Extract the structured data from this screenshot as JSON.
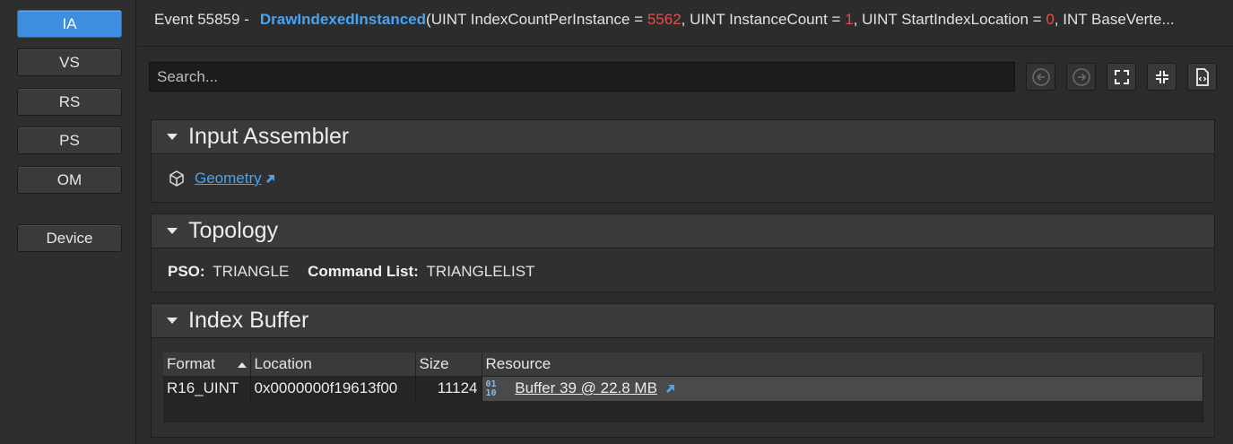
{
  "stages": [
    {
      "label": "IA",
      "active": true
    },
    {
      "label": "VS"
    },
    {
      "label": "RS"
    },
    {
      "label": "PS"
    },
    {
      "label": "OM"
    },
    {
      "label": "Device"
    }
  ],
  "event": {
    "prefix": "Event 55859 -",
    "function": "DrawIndexedInstanced",
    "params_text_1": "(UINT IndexCountPerInstance = ",
    "value_1": "5562",
    "params_text_2": ", UINT InstanceCount = ",
    "value_2": "1",
    "params_text_3": ", UINT StartIndexLocation = ",
    "value_3": "0",
    "params_text_4": ", INT BaseVerte..."
  },
  "search": {
    "placeholder": "Search..."
  },
  "toolbar_icons": [
    "back-arrow-icon",
    "forward-arrow-icon",
    "expand-icon",
    "collapse-icon",
    "export-file-icon"
  ],
  "input_assembler": {
    "title": "Input Assembler",
    "geometry_link": "Geometry"
  },
  "topology": {
    "title": "Topology",
    "pso_label": "PSO:",
    "pso_value": "TRIANGLE",
    "cmd_label": "Command List:",
    "cmd_value": "TRIANGLELIST"
  },
  "index_buffer": {
    "title": "Index Buffer",
    "columns": [
      "Format",
      "Location",
      "Size",
      "Resource"
    ],
    "rows": [
      {
        "format": "R16_UINT",
        "location": "0x0000000f19613f00",
        "size": "11124",
        "resource": "Buffer 39 @ 22.8 MB"
      }
    ]
  },
  "colors": {
    "accent": "#4aa3ef",
    "highlight": "#e0504a",
    "active_stage": "#3d8ee0"
  }
}
